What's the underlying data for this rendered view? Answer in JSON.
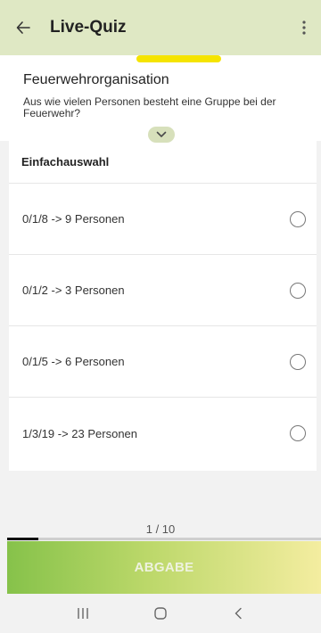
{
  "appbar": {
    "title": "Live-Quiz",
    "back_icon": "arrow-left-icon",
    "menu_icon": "more-vertical-icon"
  },
  "question": {
    "title": "Feuerwehrorganisation",
    "text": "Aus wie vielen Personen besteht eine Gruppe bei der Feuerwehr?",
    "collapse_icon": "chevron-down-icon"
  },
  "answers": {
    "type_label": "Einfachauswahl",
    "options": [
      {
        "label": "0/1/8 -> 9 Personen"
      },
      {
        "label": "0/1/2 -> 3 Personen"
      },
      {
        "label": "0/1/5 -> 6 Personen"
      },
      {
        "label": "1/3/19 -> 23 Personen"
      }
    ]
  },
  "footer": {
    "page_counter": "1 / 10",
    "progress_fraction": 0.1,
    "submit_label": "ABGABE"
  },
  "colors": {
    "appbar": "#dfe8c4",
    "accent_yellow": "#f5e400",
    "submit_start": "#86c24a",
    "submit_end": "#f4eda0"
  }
}
